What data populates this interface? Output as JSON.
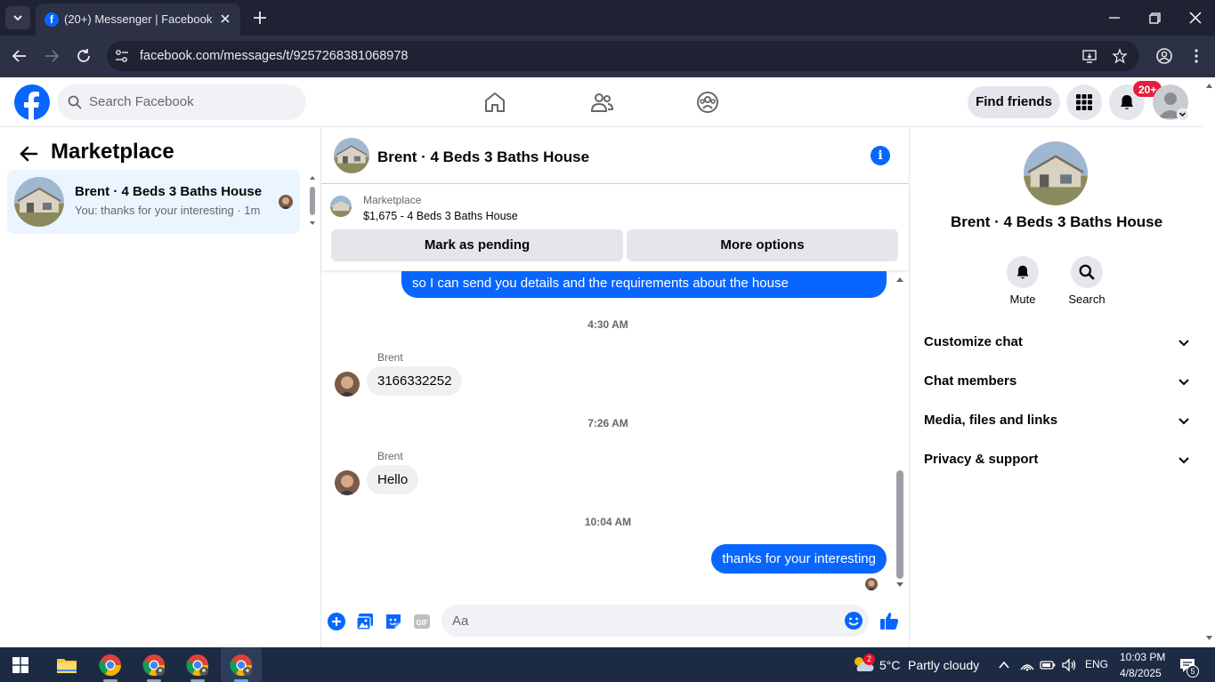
{
  "browser": {
    "tab_title": "(20+) Messenger | Facebook",
    "url": "facebook.com/messages/t/9257268381068978"
  },
  "fb": {
    "search_placeholder": "Search Facebook",
    "find_friends": "Find friends",
    "notification_count": "20+",
    "accent": "#0866ff"
  },
  "left": {
    "heading": "Marketplace",
    "conversation": {
      "name": "Brent · 4 Beds 3 Baths House",
      "preview": "You: thanks for your interesting · 1m"
    }
  },
  "chat": {
    "title": "Brent · 4 Beds 3 Baths House",
    "listing": {
      "source": "Marketplace",
      "title": "$1,675 - 4 Beds 3 Baths House"
    },
    "buttons": {
      "mark_pending": "Mark as pending",
      "more_options": "More options"
    },
    "messages": [
      {
        "type": "out",
        "text": "so I can send you details and the requirements about the house"
      },
      {
        "type": "time",
        "text": "4:30 AM"
      },
      {
        "type": "in",
        "sender": "Brent",
        "text": "3166332252"
      },
      {
        "type": "time",
        "text": "7:26 AM"
      },
      {
        "type": "in",
        "sender": "Brent",
        "text": "Hello"
      },
      {
        "type": "time",
        "text": "10:04 AM"
      },
      {
        "type": "out",
        "text": "thanks for your interesting"
      }
    ],
    "composer_placeholder": "Aa"
  },
  "right": {
    "name": "Brent · 4 Beds 3 Baths House",
    "actions": [
      {
        "label": "Mute",
        "icon": "bell-icon"
      },
      {
        "label": "Search",
        "icon": "search-icon"
      }
    ],
    "sections": [
      "Customize chat",
      "Chat members",
      "Media, files and links",
      "Privacy & support"
    ]
  },
  "taskbar": {
    "weather_temp": "5°C",
    "weather_desc": "Partly cloudy",
    "weather_badge": "2",
    "language": "ENG",
    "time": "10:03 PM",
    "date": "4/8/2025",
    "notifications": "5"
  }
}
